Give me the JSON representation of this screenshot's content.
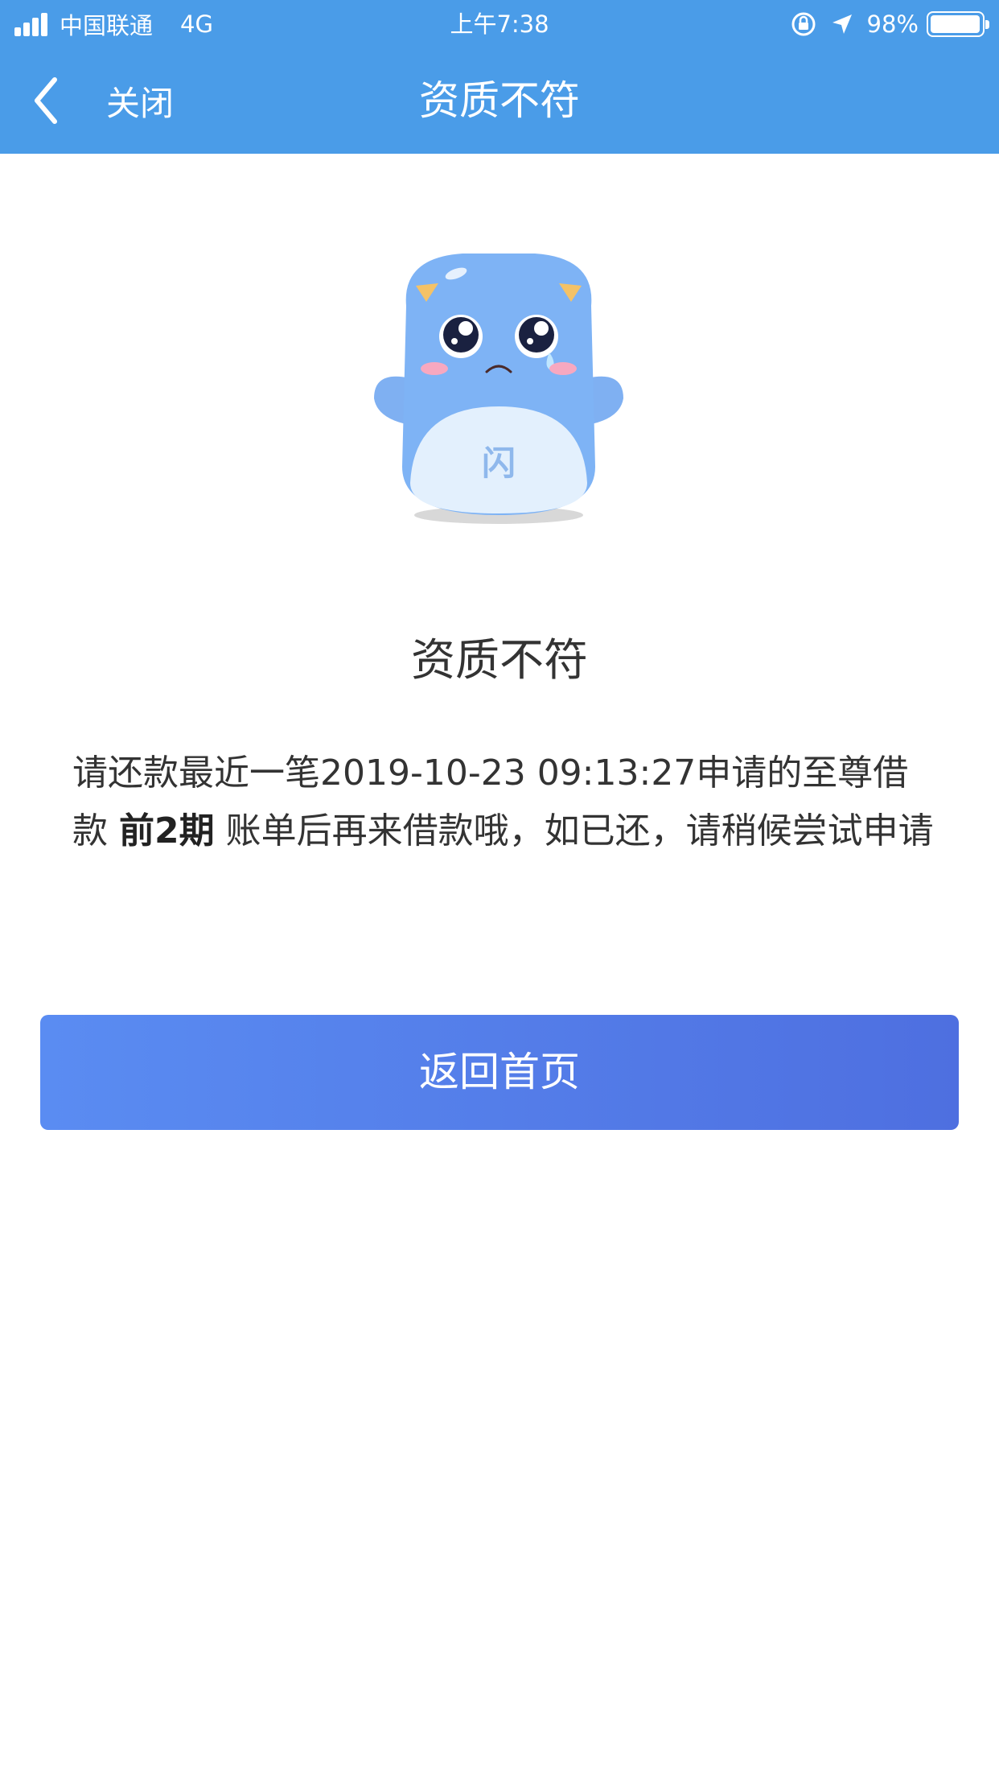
{
  "status_bar": {
    "carrier": "中国联通",
    "network": "4G",
    "time": "上午7:38",
    "battery_percent": "98%",
    "battery_level": 0.98,
    "icons": [
      "signal-icon",
      "orientation-lock-icon",
      "location-arrow-icon",
      "battery-icon"
    ]
  },
  "nav": {
    "back_label": "关闭",
    "title": "资质不符",
    "icon": "chevron-left-icon"
  },
  "mascot": {
    "badge_text": "闪"
  },
  "result": {
    "title": "资质不符",
    "message_part1": "请还款最近一笔2019-10-23 09:13:27申请的至尊借款 ",
    "message_bold": "前2期",
    "message_part2": " 账单后再来借款哦，如已还，请稍候尝试申请"
  },
  "actions": {
    "home_button_label": "返回首页"
  },
  "colors": {
    "header": "#4a9ce8",
    "button_start": "#5a8cf2",
    "button_end": "#4e6fe0",
    "text": "#333333"
  }
}
